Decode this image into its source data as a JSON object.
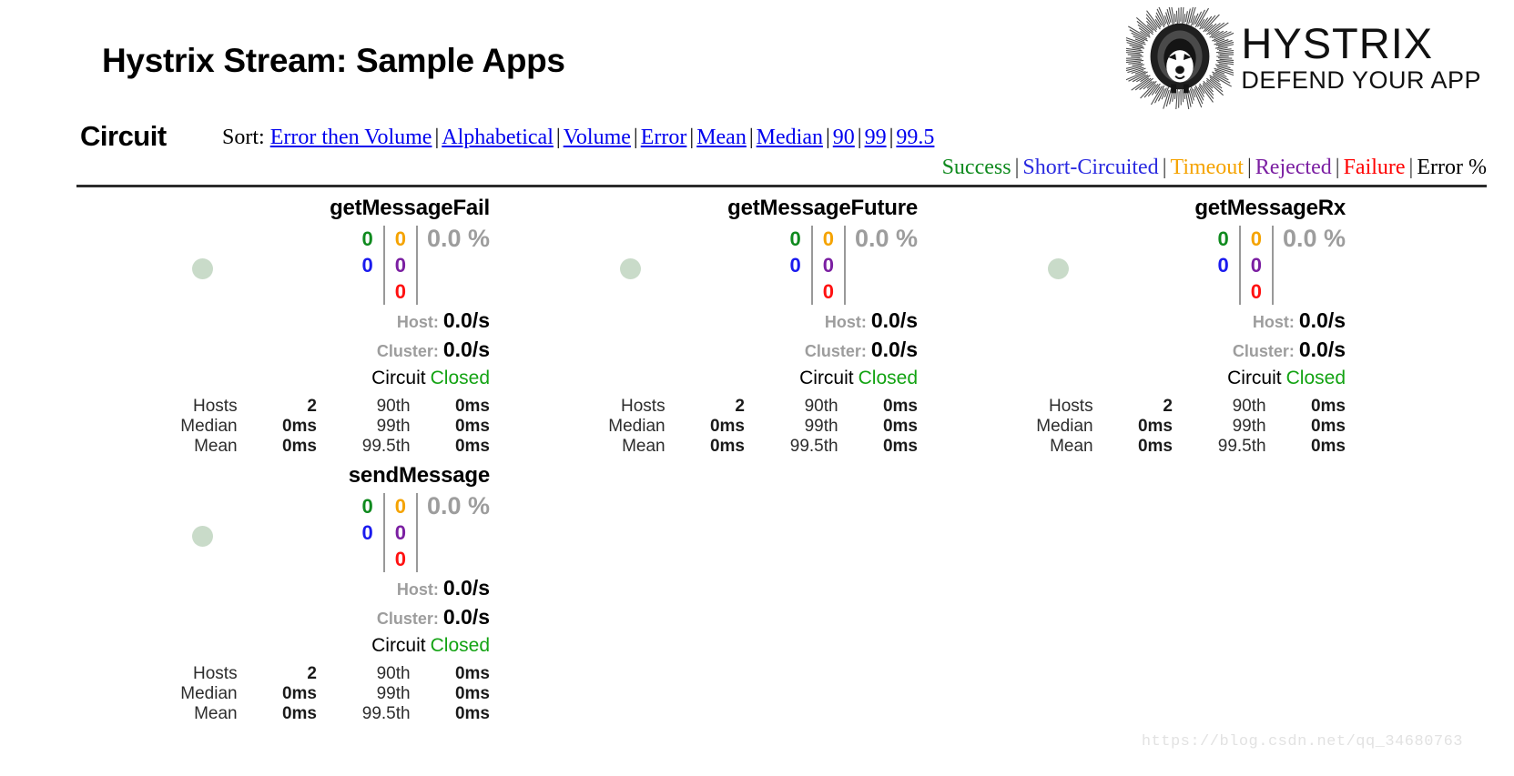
{
  "header": {
    "title": "Hystrix Stream: Sample Apps",
    "logo": {
      "name": "HYSTRIX",
      "tagline": "DEFEND YOUR APP"
    }
  },
  "circuit_section": {
    "label": "Circuit",
    "sort": {
      "prefix": "Sort:",
      "separator": "|",
      "options": [
        "Error then Volume",
        "Alphabetical",
        "Volume",
        "Error",
        "Mean",
        "Median",
        "90",
        "99",
        "99.5"
      ]
    },
    "legend": {
      "separator": "|",
      "items": [
        {
          "label": "Success",
          "color": "#0f8a1e"
        },
        {
          "label": "Short-Circuited",
          "color": "#2a2ae0"
        },
        {
          "label": "Timeout",
          "color": "#f5a300"
        },
        {
          "label": "Rejected",
          "color": "#7b1fa2"
        },
        {
          "label": "Failure",
          "color": "#ff0000"
        },
        {
          "label": "Error %",
          "color": "#000000"
        }
      ]
    }
  },
  "counter_colors": {
    "success": "#0f8a1e",
    "timeout": "#f5a300",
    "short_circuited": "#1a1aee",
    "rejected": "#7b1fa2",
    "failure": "#ff1111"
  },
  "labels": {
    "host": "Host:",
    "cluster": "Cluster:",
    "circuit": "Circuit",
    "hosts": "Hosts",
    "median": "Median",
    "mean": "Mean",
    "p90": "90th",
    "p99": "99th",
    "p995": "99.5th"
  },
  "circuits": [
    {
      "name": "getMessageFail",
      "counters": {
        "success": "0",
        "timeout": "0",
        "short_circuited": "0",
        "rejected": "0",
        "failure": "0"
      },
      "error_percent": "0.0 %",
      "host_rate": "0.0/s",
      "cluster_rate": "0.0/s",
      "status": "Closed",
      "stats": {
        "hosts": "2",
        "median": "0ms",
        "mean": "0ms",
        "p90": "0ms",
        "p99": "0ms",
        "p995": "0ms"
      }
    },
    {
      "name": "getMessageFuture",
      "counters": {
        "success": "0",
        "timeout": "0",
        "short_circuited": "0",
        "rejected": "0",
        "failure": "0"
      },
      "error_percent": "0.0 %",
      "host_rate": "0.0/s",
      "cluster_rate": "0.0/s",
      "status": "Closed",
      "stats": {
        "hosts": "2",
        "median": "0ms",
        "mean": "0ms",
        "p90": "0ms",
        "p99": "0ms",
        "p995": "0ms"
      }
    },
    {
      "name": "getMessageRx",
      "counters": {
        "success": "0",
        "timeout": "0",
        "short_circuited": "0",
        "rejected": "0",
        "failure": "0"
      },
      "error_percent": "0.0 %",
      "host_rate": "0.0/s",
      "cluster_rate": "0.0/s",
      "status": "Closed",
      "stats": {
        "hosts": "2",
        "median": "0ms",
        "mean": "0ms",
        "p90": "0ms",
        "p99": "0ms",
        "p995": "0ms"
      }
    },
    {
      "name": "sendMessage",
      "counters": {
        "success": "0",
        "timeout": "0",
        "short_circuited": "0",
        "rejected": "0",
        "failure": "0"
      },
      "error_percent": "0.0 %",
      "host_rate": "0.0/s",
      "cluster_rate": "0.0/s",
      "status": "Closed",
      "stats": {
        "hosts": "2",
        "median": "0ms",
        "mean": "0ms",
        "p90": "0ms",
        "p99": "0ms",
        "p995": "0ms"
      }
    }
  ],
  "watermark": "https://blog.csdn.net/qq_34680763"
}
